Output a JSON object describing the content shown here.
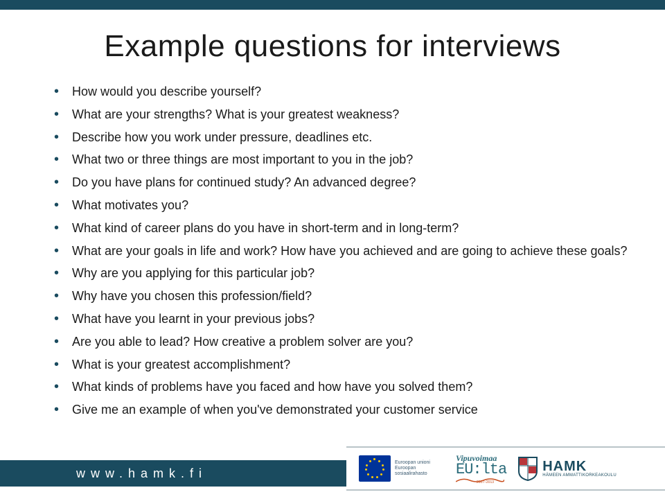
{
  "title": "Example questions for interviews",
  "questions": [
    "How would you describe yourself?",
    "What are your strengths? What is your greatest weakness?",
    "Describe how you work under pressure, deadlines etc.",
    "What two or three things are most important to you in the job?",
    "Do you have plans for continued study? An advanced degree?",
    "What motivates you?",
    "What kind of career plans do you have in short-term and in long-term?",
    "What are your goals in life and work? How have you achieved and are going to achieve these goals?",
    "Why are you applying for this particular job?",
    "Why have you chosen this profession/field?",
    "What have you learnt in your previous jobs?",
    "Are you able to lead? How creative a problem solver are you?",
    "What is your greatest accomplishment?",
    "What kinds of problems have you faced and how have you solved them?",
    "Give me an example of when you've demonstrated your customer service"
  ],
  "footer": {
    "url": "www.hamk.fi",
    "eu_caption_line1": "Euroopan unioni",
    "eu_caption_line2": "Euroopan sosiaalirahasto",
    "vipu_top": "Vipuvoimaa",
    "vipu_main": "EU:lta",
    "vipu_years": "2007–2013",
    "hamk_name": "HAMK",
    "hamk_sub": "HÄMEEN AMMATTIKORKEAKOULU"
  },
  "colors": {
    "brand_dark": "#1a4b5f",
    "brand_light": "#b9c4c8"
  }
}
